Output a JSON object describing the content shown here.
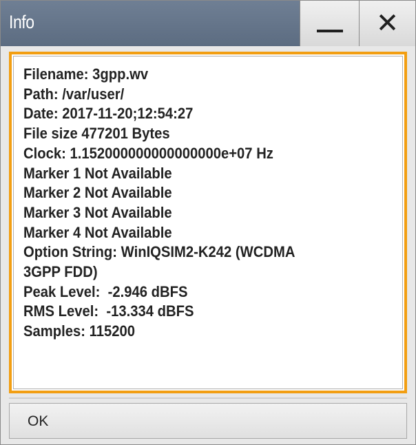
{
  "window": {
    "title": "Info"
  },
  "titlebar_buttons": {
    "minimize_icon": "minimize-icon",
    "close_icon": "close-icon",
    "close_glyph": "✕"
  },
  "info_lines": [
    "Filename: 3gpp.wv",
    "Path: /var/user/",
    "Date: 2017-11-20;12:54:27",
    "File size 477201 Bytes",
    "Clock: 1.152000000000000000e+07 Hz",
    "Marker 1 Not Available",
    "Marker 2 Not Available",
    "Marker 3 Not Available",
    "Marker 4 Not Available",
    "Option String: WinIQSIM2-K242 (WCDMA",
    "3GPP FDD)",
    "Peak Level:  -2.946 dBFS",
    "RMS Level:  -13.334 dBFS",
    "Samples: 115200"
  ],
  "buttons": {
    "ok_label": "OK"
  },
  "colors": {
    "titlebar": "#5c6c81",
    "focus_border": "#f29e12",
    "text": "#222222"
  }
}
